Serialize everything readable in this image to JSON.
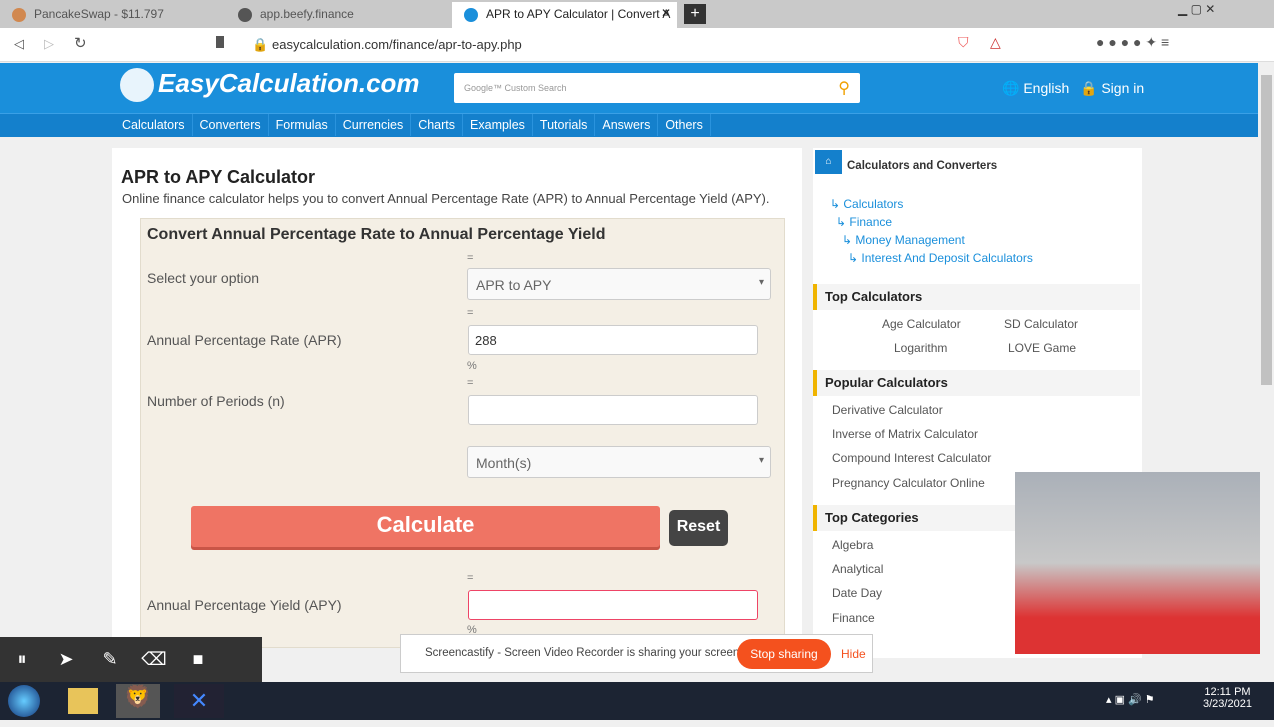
{
  "browser": {
    "tabs": [
      {
        "label": "PancakeSwap - $11.797"
      },
      {
        "label": "app.beefy.finance"
      },
      {
        "label": "APR to APY Calculator | Convert A"
      }
    ],
    "url": "easycalculation.com/finance/apr-to-apy.php"
  },
  "site": {
    "logo": "EasyCalculation.com",
    "search_placeholder": "Google™ Custom Search",
    "language": "English",
    "signin": "Sign in",
    "nav": [
      "Calculators",
      "Converters",
      "Formulas",
      "Currencies",
      "Charts",
      "Examples",
      "Tutorials",
      "Answers",
      "Others"
    ]
  },
  "main": {
    "title": "APR to APY Calculator",
    "subtitle": "Online finance calculator helps you to convert Annual Percentage Rate (APR) to Annual Percentage Yield (APY).",
    "box_title": "Convert Annual Percentage Rate to Annual Percentage Yield",
    "option_label": "Select your option",
    "option_value": "APR to APY",
    "apr_label": "Annual Percentage Rate (APR)",
    "apr_value": "288",
    "pct": "%",
    "eq": "=",
    "periods_label": "Number of Periods (n)",
    "periods_value": "",
    "period_unit": "Month(s)",
    "calculate": "Calculate",
    "reset": "Reset",
    "apy_label": "Annual Percentage Yield (APY)",
    "apy_value": ""
  },
  "sidebar": {
    "title": "Calculators and Converters",
    "breadcrumbs": [
      "Calculators",
      "Finance",
      "Money Management",
      "Interest And Deposit Calculators"
    ],
    "top_title": "Top Calculators",
    "top": [
      "Age Calculator",
      "SD Calculator",
      "Logarithm",
      "LOVE Game"
    ],
    "popular_title": "Popular Calculators",
    "popular": [
      "Derivative Calculator",
      "Inverse of Matrix Calculator",
      "Compound Interest Calculator",
      "Pregnancy Calculator Online"
    ],
    "cat_title": "Top Categories",
    "categories": [
      "Algebra",
      "Analytical",
      "Date Day",
      "Finance"
    ]
  },
  "share": {
    "text": "Screencastify - Screen Video Recorder is sharing your screen.",
    "stop": "Stop sharing",
    "hide": "Hide"
  },
  "taskbar": {
    "time": "12:11 PM",
    "date": "3/23/2021"
  }
}
